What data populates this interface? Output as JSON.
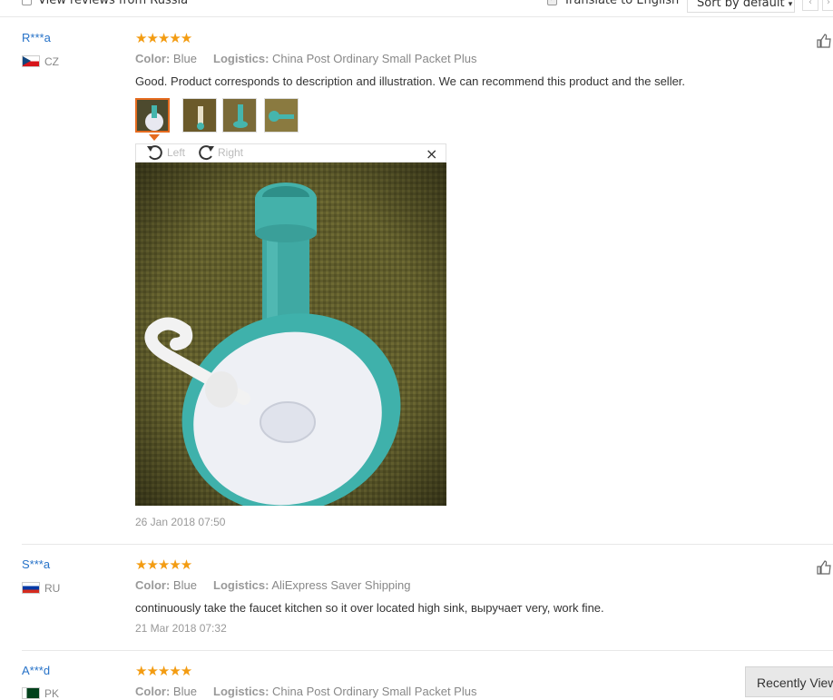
{
  "filters": {
    "view_reviews_label": "View reviews from Russia",
    "view_reviews_checked": false,
    "translate_label": "Translate to English",
    "translate_checked": true,
    "sort_label": "Sort by default",
    "sort_caret": "▾",
    "prev_page": "‹",
    "next_page": "›"
  },
  "reviews": [
    {
      "user": "R***a",
      "country": "CZ",
      "stars": "★★★★★",
      "rating": 5,
      "color_label": "Color:",
      "color_value": "Blue",
      "logistics_label": "Logistics:",
      "logistics_value": "China Post Ordinary Small Packet Plus",
      "comment": "Good. Product corresponds to description and illustration. We can recommend this product and the seller.",
      "date": "26 Jan 2018 07:50",
      "photo_count": 4
    },
    {
      "user": "S***a",
      "country": "RU",
      "stars": "★★★★★",
      "rating": 5,
      "color_label": "Color:",
      "color_value": "Blue",
      "logistics_label": "Logistics:",
      "logistics_value": "AliExpress Saver Shipping",
      "comment": "continuously take the faucet kitchen so it over located high sink, выручает very, work fine.",
      "date": "21 Mar 2018 07:32"
    },
    {
      "user": "A***d",
      "country": "PK",
      "stars": "★★★★★",
      "rating": 5,
      "color_label": "Color:",
      "color_value": "Blue",
      "logistics_label": "Logistics:",
      "logistics_value": "China Post Ordinary Small Packet Plus"
    }
  ],
  "viewer": {
    "rotate_left": "Left",
    "rotate_right": "Right",
    "close": "×"
  },
  "recently_viewed": "Recently Viewed",
  "colors": {
    "link": "#2672c8",
    "star": "#f39c12",
    "active_thumb": "#e56b1f"
  }
}
